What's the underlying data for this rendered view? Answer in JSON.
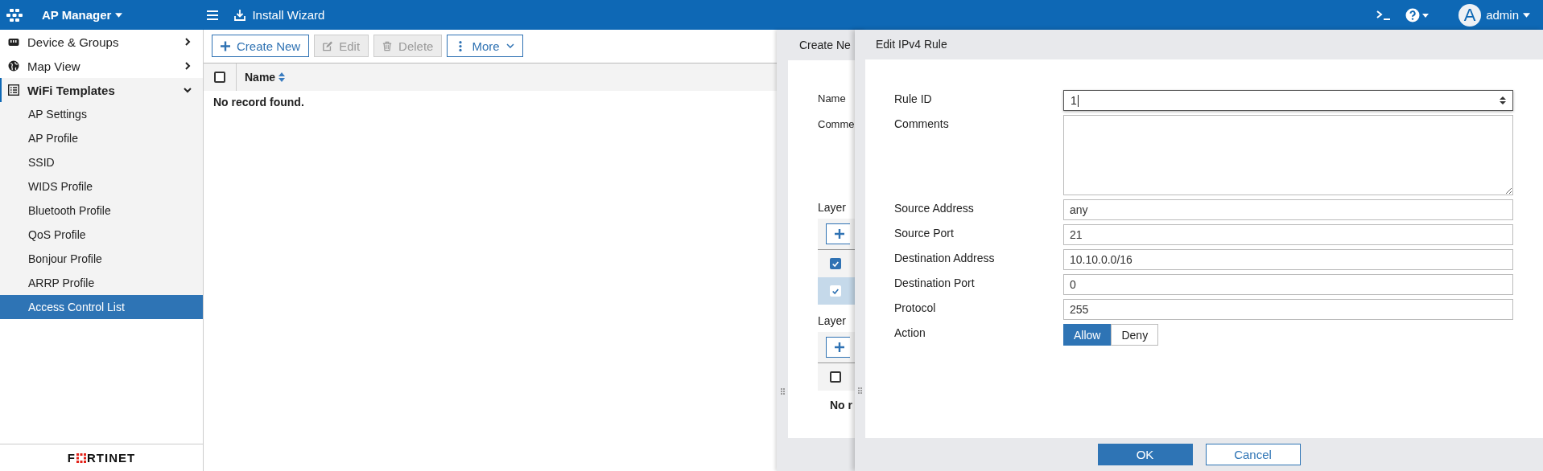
{
  "topbar": {
    "app_title": "AP Manager",
    "install_wizard": "Install Wizard",
    "avatar_letter": "A",
    "user": "admin"
  },
  "sidebar": {
    "items": [
      {
        "label": "Device & Groups",
        "kind": "device",
        "active": false,
        "expanded": false
      },
      {
        "label": "Map View",
        "kind": "globe",
        "active": false,
        "expanded": false
      },
      {
        "label": "WiFi Templates",
        "kind": "list",
        "active": true,
        "expanded": true,
        "children": [
          {
            "label": "AP Settings",
            "selected": false
          },
          {
            "label": "AP Profile",
            "selected": false
          },
          {
            "label": "SSID",
            "selected": false
          },
          {
            "label": "WIDS Profile",
            "selected": false
          },
          {
            "label": "Bluetooth Profile",
            "selected": false
          },
          {
            "label": "QoS Profile",
            "selected": false
          },
          {
            "label": "Bonjour Profile",
            "selected": false
          },
          {
            "label": "ARRP Profile",
            "selected": false
          },
          {
            "label": "Access Control List",
            "selected": true
          }
        ]
      }
    ],
    "logo": {
      "before": "F",
      "after": "RTINET"
    }
  },
  "toolbar": [
    {
      "label": "Create New",
      "kind": "plus",
      "disabled": false
    },
    {
      "label": "Edit",
      "kind": "edit",
      "disabled": true
    },
    {
      "label": "Delete",
      "kind": "trash",
      "disabled": true
    },
    {
      "label": "More",
      "kind": "more",
      "disabled": false
    }
  ],
  "table": {
    "select_all_checked": false,
    "columns": [
      "Name"
    ],
    "empty_text": "No record found."
  },
  "back_panel": {
    "title": "Create Ne",
    "labels": [
      "Name",
      "Comme"
    ],
    "sections": [
      {
        "label": "Layer",
        "rows": [
          {
            "checked": true,
            "selected": false
          },
          {
            "checked": true,
            "selected": true
          }
        ]
      },
      {
        "label": "Layer",
        "rows": [
          {
            "checked": false,
            "selected": false
          }
        ],
        "empty_text": "No r"
      }
    ]
  },
  "dialog": {
    "title": "Edit IPv4 Rule",
    "fields": [
      {
        "label": "Rule ID",
        "kind": "spin",
        "value": "1"
      },
      {
        "label": "Comments",
        "kind": "textarea"
      },
      {
        "label": "Source Address",
        "kind": "text",
        "value": "any"
      },
      {
        "label": "Source Port",
        "kind": "text",
        "value": "21"
      },
      {
        "label": "Destination Address",
        "kind": "text",
        "value": "10.10.0.0/16"
      },
      {
        "label": "Destination Port",
        "kind": "text",
        "value": "0"
      },
      {
        "label": "Protocol",
        "kind": "text",
        "value": "255"
      },
      {
        "label": "Action",
        "kind": "toggle",
        "options": [
          {
            "label": "Allow",
            "selected": true
          },
          {
            "label": "Deny",
            "selected": false
          }
        ]
      }
    ],
    "buttons": [
      {
        "label": "OK",
        "kind": "primary"
      },
      {
        "label": "Cancel",
        "kind": "secondary"
      }
    ]
  }
}
